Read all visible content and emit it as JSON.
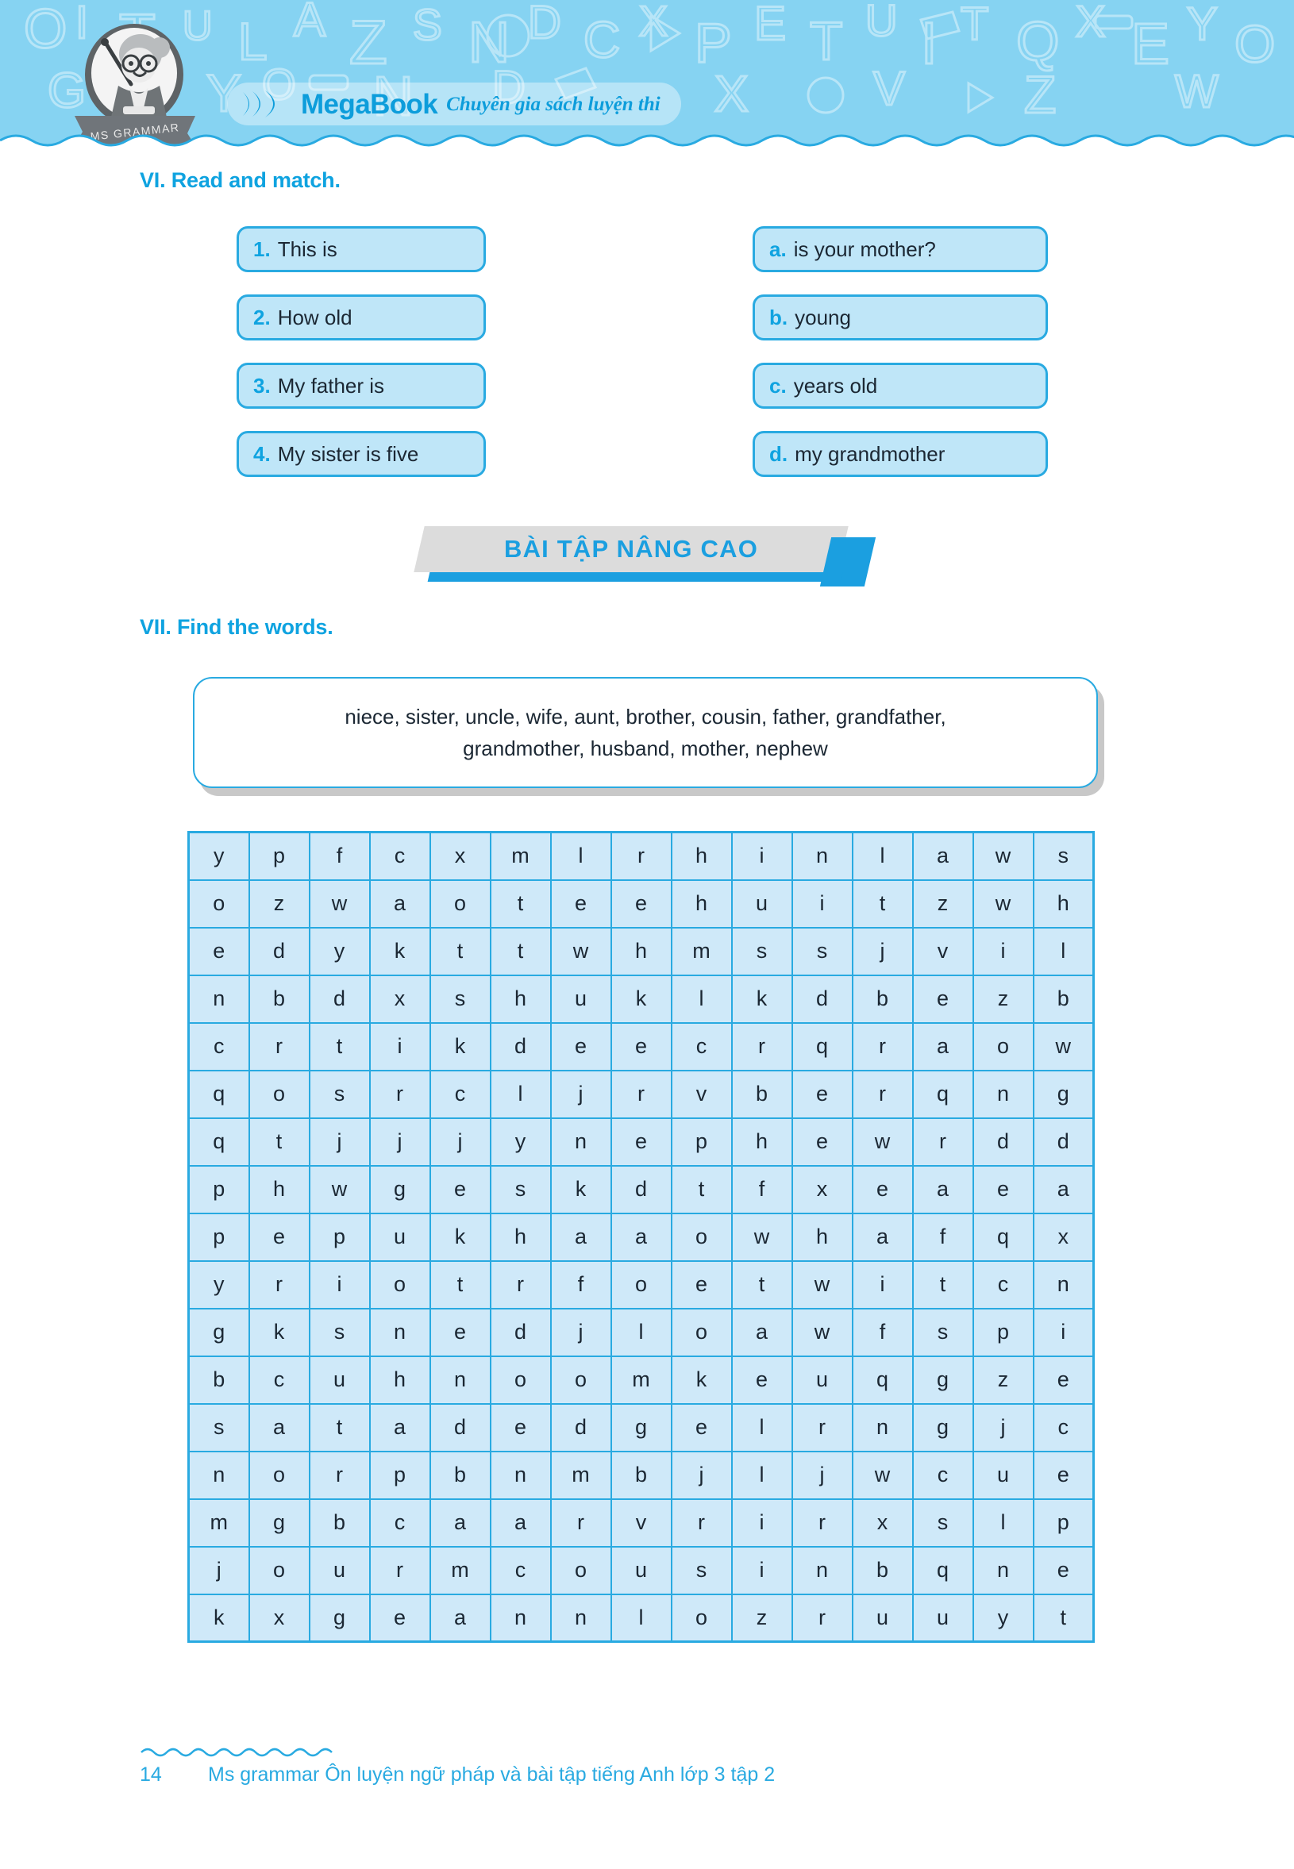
{
  "header": {
    "logo_text": "MegaBook",
    "logo_tagline": "Chuyên gia sách luyện thi",
    "mascot_ribbon_label": "MS GRAMMAR",
    "brand_color": "#0d9ddb",
    "banner_bg": "#86d3f2"
  },
  "section_vi": {
    "heading": "VI. Read and match.",
    "left_items": [
      {
        "label": "1.",
        "text": "This is"
      },
      {
        "label": "2.",
        "text": "How old"
      },
      {
        "label": "3.",
        "text": "My father is"
      },
      {
        "label": "4.",
        "text": "My sister is five"
      }
    ],
    "right_items": [
      {
        "label": "a.",
        "text": "is your mother?"
      },
      {
        "label": "b.",
        "text": "young"
      },
      {
        "label": "c.",
        "text": "years old"
      },
      {
        "label": "d.",
        "text": "my grandmother"
      }
    ]
  },
  "advanced_banner": {
    "title": "BÀI TẬP NÂNG CAO",
    "gray": "#dcdcdc",
    "blue": "#1b9fe0"
  },
  "section_vii": {
    "heading": "VII. Find the words.",
    "wordbank_line1": "niece, sister, uncle, wife, aunt, brother, cousin, father, grandfather,",
    "wordbank_line2": "grandmother, husband, mother, nephew",
    "words": [
      "niece",
      "sister",
      "uncle",
      "wife",
      "aunt",
      "brother",
      "cousin",
      "father",
      "grandfather",
      "grandmother",
      "husband",
      "mother",
      "nephew"
    ],
    "grid": {
      "rows": 17,
      "cols": 15,
      "letters": [
        [
          "y",
          "p",
          "f",
          "c",
          "x",
          "m",
          "l",
          "r",
          "h",
          "i",
          "n",
          "l",
          "a",
          "w",
          "s"
        ],
        [
          "o",
          "z",
          "w",
          "a",
          "o",
          "t",
          "e",
          "e",
          "h",
          "u",
          "i",
          "t",
          "z",
          "w",
          "h"
        ],
        [
          "e",
          "d",
          "y",
          "k",
          "t",
          "t",
          "w",
          "h",
          "m",
          "s",
          "s",
          "j",
          "v",
          "i",
          "l"
        ],
        [
          "n",
          "b",
          "d",
          "x",
          "s",
          "h",
          "u",
          "k",
          "l",
          "k",
          "d",
          "b",
          "e",
          "z",
          "b"
        ],
        [
          "c",
          "r",
          "t",
          "i",
          "k",
          "d",
          "e",
          "e",
          "c",
          "r",
          "q",
          "r",
          "a",
          "o",
          "w"
        ],
        [
          "q",
          "o",
          "s",
          "r",
          "c",
          "l",
          "j",
          "r",
          "v",
          "b",
          "e",
          "r",
          "q",
          "n",
          "g"
        ],
        [
          "q",
          "t",
          "j",
          "j",
          "j",
          "y",
          "n",
          "e",
          "p",
          "h",
          "e",
          "w",
          "r",
          "d",
          "d"
        ],
        [
          "p",
          "h",
          "w",
          "g",
          "e",
          "s",
          "k",
          "d",
          "t",
          "f",
          "x",
          "e",
          "a",
          "e",
          "a"
        ],
        [
          "p",
          "e",
          "p",
          "u",
          "k",
          "h",
          "a",
          "a",
          "o",
          "w",
          "h",
          "a",
          "f",
          "q",
          "x"
        ],
        [
          "y",
          "r",
          "i",
          "o",
          "t",
          "r",
          "f",
          "o",
          "e",
          "t",
          "w",
          "i",
          "t",
          "c",
          "n"
        ],
        [
          "g",
          "k",
          "s",
          "n",
          "e",
          "d",
          "j",
          "l",
          "o",
          "a",
          "w",
          "f",
          "s",
          "p",
          "i"
        ],
        [
          "b",
          "c",
          "u",
          "h",
          "n",
          "o",
          "o",
          "m",
          "k",
          "e",
          "u",
          "q",
          "g",
          "z",
          "e"
        ],
        [
          "s",
          "a",
          "t",
          "a",
          "d",
          "e",
          "d",
          "g",
          "e",
          "l",
          "r",
          "n",
          "g",
          "j",
          "c"
        ],
        [
          "n",
          "o",
          "r",
          "p",
          "b",
          "n",
          "m",
          "b",
          "j",
          "l",
          "j",
          "w",
          "c",
          "u",
          "e"
        ],
        [
          "m",
          "g",
          "b",
          "c",
          "a",
          "a",
          "r",
          "v",
          "r",
          "i",
          "r",
          "x",
          "s",
          "l",
          "p"
        ],
        [
          "j",
          "o",
          "u",
          "r",
          "m",
          "c",
          "o",
          "u",
          "s",
          "i",
          "n",
          "b",
          "q",
          "n",
          "e"
        ],
        [
          "k",
          "x",
          "g",
          "e",
          "a",
          "n",
          "n",
          "l",
          "o",
          "z",
          "r",
          "u",
          "u",
          "y",
          "t"
        ]
      ]
    }
  },
  "footer": {
    "page_number": "14",
    "title": "Ms grammar Ôn luyện ngữ pháp và bài tập tiếng Anh lớp 3 tập 2"
  }
}
